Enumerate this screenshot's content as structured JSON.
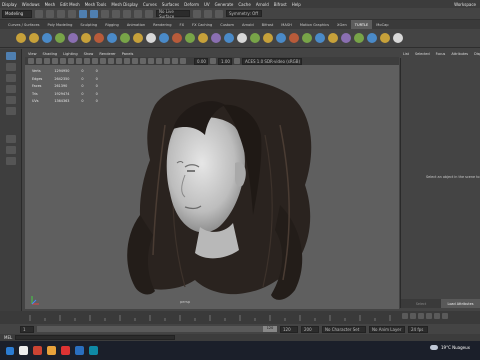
{
  "menubar": [
    "Display",
    "Windows",
    "Mesh",
    "Edit Mesh",
    "Mesh Tools",
    "Mesh Display",
    "Curves",
    "Surfaces",
    "Deform",
    "UV",
    "Generate",
    "Cache",
    "Arnold",
    "Bifrost",
    "Help"
  ],
  "menubar_right": "Workspace",
  "statusline": {
    "mode": "Modeling",
    "live_surface": "No Live Surface",
    "symmetry": "Symmetry: Off"
  },
  "shelf_tabs": [
    "Curves / Surfaces",
    "Poly Modeling",
    "Sculpting",
    "Rigging",
    "Animation",
    "Rendering",
    "FX",
    "FX Caching",
    "Custom",
    "Arnold",
    "Bifrost",
    "MASH",
    "Motion Graphics",
    "XGen",
    "TURTLE",
    "MoCap"
  ],
  "shelf_active_index": 14,
  "panel_menu": [
    "View",
    "Shading",
    "Lighting",
    "Show",
    "Renderer",
    "Panels"
  ],
  "panel_fields": {
    "near": "0.00",
    "far": "1.00",
    "colorspace": "ACES 1.0 SDR-video (sRGB)"
  },
  "hud": [
    {
      "label": "Verts",
      "v1": "1294950",
      "v2": "0",
      "v3": "0"
    },
    {
      "label": "Edges",
      "v1": "2642350",
      "v2": "0",
      "v3": "0"
    },
    {
      "label": "Faces",
      "v1": "261390",
      "v2": "0",
      "v3": "0"
    },
    {
      "label": "Tris",
      "v1": "1929474",
      "v2": "0",
      "v3": "0"
    },
    {
      "label": "UVs",
      "v1": "1364363",
      "v2": "0",
      "v3": "0"
    }
  ],
  "camera_label": "persp",
  "attr_tabs": [
    "List",
    "Selected",
    "Focus",
    "Attributes",
    "Display",
    "Show"
  ],
  "attr_message": "Select an object in the scene to",
  "attr_buttons": {
    "load": "Select",
    "copy": "Load Attributes"
  },
  "range": {
    "start": "1",
    "end": "120",
    "anim_end": "200",
    "character_set": "No Character Set",
    "anim_layer": "No Anim Layer",
    "fps": "24 fps"
  },
  "cmdline_label": "MEL",
  "taskbar": {
    "weather": "19°C  Nuageux"
  },
  "colors": {
    "accent": "#5d9bd5",
    "viewport": "#5f5f5f"
  }
}
